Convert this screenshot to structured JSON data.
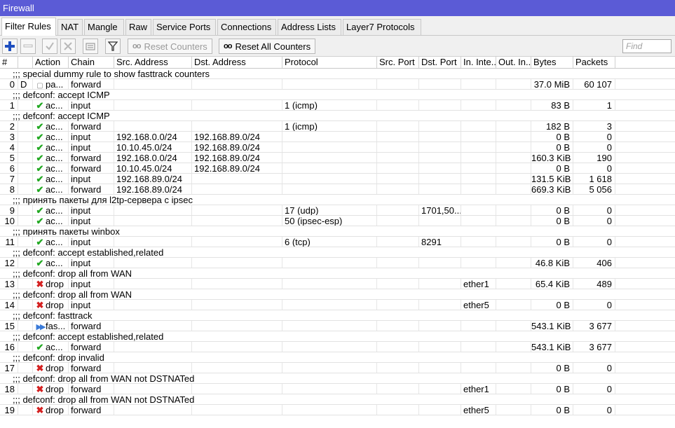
{
  "window": {
    "title": "Firewall"
  },
  "tabs": [
    "Filter Rules",
    "NAT",
    "Mangle",
    "Raw",
    "Service Ports",
    "Connections",
    "Address Lists",
    "Layer7 Protocols"
  ],
  "toolbar": {
    "reset_counters": "Reset Counters",
    "reset_all_counters": "Reset All Counters",
    "counter_glyph": "oo"
  },
  "search": {
    "placeholder": "Find"
  },
  "columns": [
    "#",
    "",
    "Action",
    "Chain",
    "Src. Address",
    "Dst. Address",
    "Protocol",
    "Src. Port",
    "Dst. Port",
    "In. Inte...",
    "Out. In...",
    "Bytes",
    "Packets"
  ],
  "rows": [
    {
      "type": "comment",
      "text": ";;; special dummy rule to show fasttrack counters"
    },
    {
      "type": "rule",
      "num": "0",
      "flag": "D",
      "icon": "passthrough-icon",
      "action": "pa...",
      "chain": "forward",
      "src": "",
      "dst": "",
      "proto": "",
      "sport": "",
      "dport": "",
      "in": "",
      "out": "",
      "bytes": "37.0 MiB",
      "packets": "60 107"
    },
    {
      "type": "comment",
      "text": ";;; defconf: accept ICMP"
    },
    {
      "type": "rule",
      "num": "1",
      "flag": "",
      "icon": "accept-icon",
      "action": "ac...",
      "chain": "input",
      "src": "",
      "dst": "",
      "proto": "1 (icmp)",
      "sport": "",
      "dport": "",
      "in": "",
      "out": "",
      "bytes": "83 B",
      "packets": "1"
    },
    {
      "type": "comment",
      "text": ";;; defconf: accept ICMP"
    },
    {
      "type": "rule",
      "num": "2",
      "flag": "",
      "icon": "accept-icon",
      "action": "ac...",
      "chain": "forward",
      "src": "",
      "dst": "",
      "proto": "1 (icmp)",
      "sport": "",
      "dport": "",
      "in": "",
      "out": "",
      "bytes": "182 B",
      "packets": "3"
    },
    {
      "type": "rule",
      "num": "3",
      "flag": "",
      "icon": "accept-icon",
      "action": "ac...",
      "chain": "input",
      "src": "192.168.0.0/24",
      "dst": "192.168.89.0/24",
      "proto": "",
      "sport": "",
      "dport": "",
      "in": "",
      "out": "",
      "bytes": "0 B",
      "packets": "0"
    },
    {
      "type": "rule",
      "num": "4",
      "flag": "",
      "icon": "accept-icon",
      "action": "ac...",
      "chain": "input",
      "src": "10.10.45.0/24",
      "dst": "192.168.89.0/24",
      "proto": "",
      "sport": "",
      "dport": "",
      "in": "",
      "out": "",
      "bytes": "0 B",
      "packets": "0"
    },
    {
      "type": "rule",
      "num": "5",
      "flag": "",
      "icon": "accept-icon",
      "action": "ac...",
      "chain": "forward",
      "src": "192.168.0.0/24",
      "dst": "192.168.89.0/24",
      "proto": "",
      "sport": "",
      "dport": "",
      "in": "",
      "out": "",
      "bytes": "160.3 KiB",
      "packets": "190"
    },
    {
      "type": "rule",
      "num": "6",
      "flag": "",
      "icon": "accept-icon",
      "action": "ac...",
      "chain": "forward",
      "src": "10.10.45.0/24",
      "dst": "192.168.89.0/24",
      "proto": "",
      "sport": "",
      "dport": "",
      "in": "",
      "out": "",
      "bytes": "0 B",
      "packets": "0"
    },
    {
      "type": "rule",
      "num": "7",
      "flag": "",
      "icon": "accept-icon",
      "action": "ac...",
      "chain": "input",
      "src": "192.168.89.0/24",
      "dst": "",
      "proto": "",
      "sport": "",
      "dport": "",
      "in": "",
      "out": "",
      "bytes": "131.5 KiB",
      "packets": "1 618"
    },
    {
      "type": "rule",
      "num": "8",
      "flag": "",
      "icon": "accept-icon",
      "action": "ac...",
      "chain": "forward",
      "src": "192.168.89.0/24",
      "dst": "",
      "proto": "",
      "sport": "",
      "dport": "",
      "in": "",
      "out": "",
      "bytes": "669.3 KiB",
      "packets": "5 056"
    },
    {
      "type": "comment",
      "text": ";;; принять пакеты для l2tp-сервера с ipsec"
    },
    {
      "type": "rule",
      "num": "9",
      "flag": "",
      "icon": "accept-icon",
      "action": "ac...",
      "chain": "input",
      "src": "",
      "dst": "",
      "proto": "17 (udp)",
      "sport": "",
      "dport": "1701,50...",
      "in": "",
      "out": "",
      "bytes": "0 B",
      "packets": "0"
    },
    {
      "type": "rule",
      "num": "10",
      "flag": "",
      "icon": "accept-icon",
      "action": "ac...",
      "chain": "input",
      "src": "",
      "dst": "",
      "proto": "50 (ipsec-esp)",
      "sport": "",
      "dport": "",
      "in": "",
      "out": "",
      "bytes": "0 B",
      "packets": "0"
    },
    {
      "type": "comment",
      "text": ";;; принять пакеты winbox"
    },
    {
      "type": "rule",
      "num": "11",
      "flag": "",
      "icon": "accept-icon",
      "action": "ac...",
      "chain": "input",
      "src": "",
      "dst": "",
      "proto": "6 (tcp)",
      "sport": "",
      "dport": "8291",
      "in": "",
      "out": "",
      "bytes": "0 B",
      "packets": "0"
    },
    {
      "type": "comment",
      "text": ";;; defconf: accept established,related"
    },
    {
      "type": "rule",
      "num": "12",
      "flag": "",
      "icon": "accept-icon",
      "action": "ac...",
      "chain": "input",
      "src": "",
      "dst": "",
      "proto": "",
      "sport": "",
      "dport": "",
      "in": "",
      "out": "",
      "bytes": "46.8 KiB",
      "packets": "406"
    },
    {
      "type": "comment",
      "text": ";;; defconf: drop all from WAN"
    },
    {
      "type": "rule",
      "num": "13",
      "flag": "",
      "icon": "drop-icon",
      "action": "drop",
      "chain": "input",
      "src": "",
      "dst": "",
      "proto": "",
      "sport": "",
      "dport": "",
      "in": "ether1",
      "out": "",
      "bytes": "65.4 KiB",
      "packets": "489"
    },
    {
      "type": "comment",
      "text": ";;; defconf: drop all from WAN"
    },
    {
      "type": "rule",
      "num": "14",
      "flag": "",
      "icon": "drop-icon",
      "action": "drop",
      "chain": "input",
      "src": "",
      "dst": "",
      "proto": "",
      "sport": "",
      "dport": "",
      "in": "ether5",
      "out": "",
      "bytes": "0 B",
      "packets": "0"
    },
    {
      "type": "comment",
      "text": ";;; defconf: fasttrack"
    },
    {
      "type": "rule",
      "num": "15",
      "flag": "",
      "icon": "fasttrack-icon",
      "action": "fas...",
      "chain": "forward",
      "src": "",
      "dst": "",
      "proto": "",
      "sport": "",
      "dport": "",
      "in": "",
      "out": "",
      "bytes": "543.1 KiB",
      "packets": "3 677"
    },
    {
      "type": "comment",
      "text": ";;; defconf: accept established,related"
    },
    {
      "type": "rule",
      "num": "16",
      "flag": "",
      "icon": "accept-icon",
      "action": "ac...",
      "chain": "forward",
      "src": "",
      "dst": "",
      "proto": "",
      "sport": "",
      "dport": "",
      "in": "",
      "out": "",
      "bytes": "543.1 KiB",
      "packets": "3 677"
    },
    {
      "type": "comment",
      "text": ";;; defconf: drop invalid"
    },
    {
      "type": "rule",
      "num": "17",
      "flag": "",
      "icon": "drop-icon",
      "action": "drop",
      "chain": "forward",
      "src": "",
      "dst": "",
      "proto": "",
      "sport": "",
      "dport": "",
      "in": "",
      "out": "",
      "bytes": "0 B",
      "packets": "0"
    },
    {
      "type": "comment",
      "text": ";;; defconf:  drop all from WAN not DSTNATed"
    },
    {
      "type": "rule",
      "num": "18",
      "flag": "",
      "icon": "drop-icon",
      "action": "drop",
      "chain": "forward",
      "src": "",
      "dst": "",
      "proto": "",
      "sport": "",
      "dport": "",
      "in": "ether1",
      "out": "",
      "bytes": "0 B",
      "packets": "0"
    },
    {
      "type": "comment",
      "text": ";;; defconf:  drop all from WAN not DSTNATed"
    },
    {
      "type": "rule",
      "num": "19",
      "flag": "",
      "icon": "drop-icon",
      "action": "drop",
      "chain": "forward",
      "src": "",
      "dst": "",
      "proto": "",
      "sport": "",
      "dport": "",
      "in": "ether5",
      "out": "",
      "bytes": "0 B",
      "packets": "0"
    }
  ],
  "colors": {
    "titlebar": "#5b5bd6",
    "accept": "#22a822",
    "drop": "#d42020",
    "fasttrack": "#3a7ad8"
  }
}
